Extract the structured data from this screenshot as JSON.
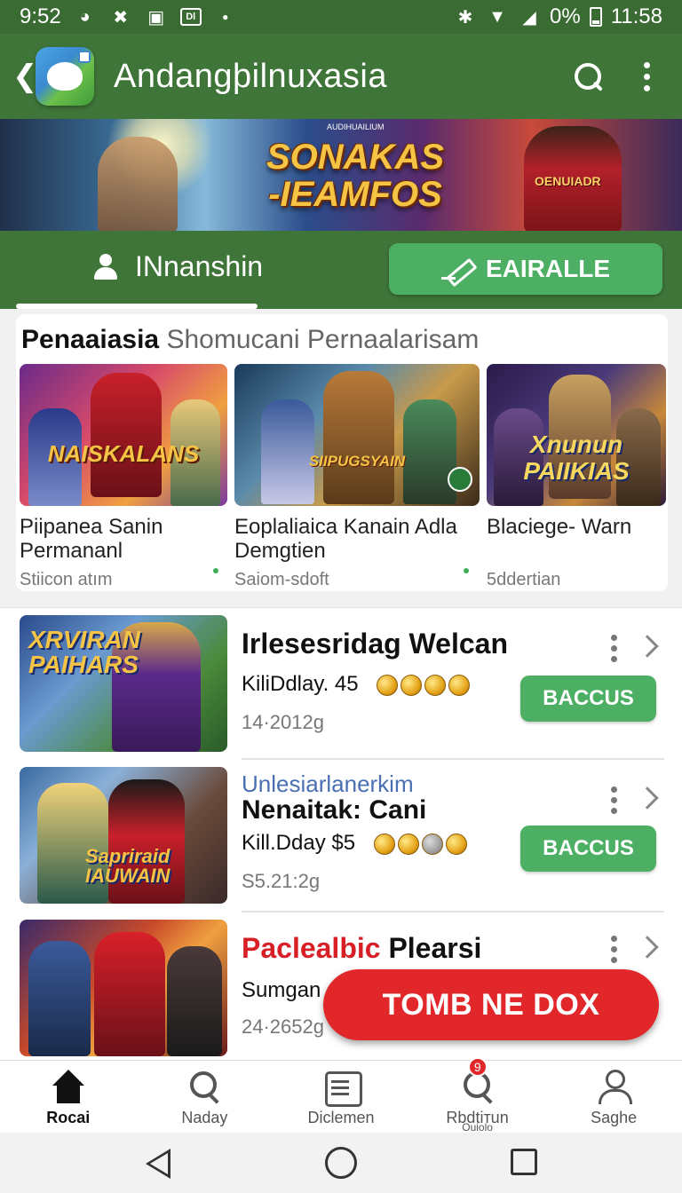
{
  "status": {
    "time_left": "9:52",
    "battery_pct": "0%",
    "time_right": "11:58",
    "icons": [
      "clock-icon",
      "x-icon",
      "image-icon",
      "dl-icon",
      "bluetooth-icon",
      "wifi-icon",
      "signal-icon",
      "battery-icon"
    ],
    "dl_label": "Dl"
  },
  "appbar": {
    "title": "Andangþilnuxasia"
  },
  "banner": {
    "title_line1": "SONAKAS",
    "title_line2": "-IEAMFOS",
    "tag": "OENUIADR",
    "small_text": "AUDIHUAILIUM"
  },
  "tabs": {
    "profile_label": "INnanshin",
    "edit_label": "EAIRALLE"
  },
  "featured": {
    "title_bold": "Penaaiasia",
    "title_rest": "Shomucani Pernaalarisam",
    "items": [
      {
        "art_label": "NAISKALANS",
        "name": "Piipanea Sanin Permananl",
        "meta": "Stiicon atım"
      },
      {
        "art_label": "SIIPUGSYAIN",
        "name": "Eoplaliaica Kanain Adla Demgtien",
        "meta": "Saiom-sdoft"
      },
      {
        "art_label": "Xnunun PAIIKIAS",
        "name": "Blaciege- Warn",
        "meta": "5ddertian"
      }
    ]
  },
  "list": [
    {
      "art_label": "XRVIRAN PAIHARS",
      "subtitle": "",
      "title": "Irlesesridag Welcan",
      "line": "KiliDdlay. 45",
      "date": "14·2012g",
      "button": "BACCUS"
    },
    {
      "art_label": "Sapriraid IAUWAIN",
      "subtitle": "Unlesiarlanerkim",
      "title": "Nenaitak: Cani",
      "line": "Kill.Dday $5",
      "date": "S5.21:2g",
      "button": "BACCUS"
    },
    {
      "art_label": "",
      "subtitle": "",
      "title_red": "Paclealbic",
      "title": "Plearsi",
      "line": "Sumgan",
      "date": "24·2652g",
      "button": ""
    }
  ],
  "fab": {
    "label": "TOMB NE DOX"
  },
  "bottom_nav": [
    {
      "label": "Rocai",
      "icon": "home-icon",
      "active": true
    },
    {
      "label": "Naday",
      "icon": "search-icon",
      "active": false
    },
    {
      "label": "Diclemen",
      "icon": "document-icon",
      "active": false
    },
    {
      "label": "Rbdtiтun",
      "icon": "search-notify-icon",
      "active": false,
      "badge": "9",
      "sub": "Ouiolo"
    },
    {
      "label": "Saghe",
      "icon": "user-icon",
      "active": false
    }
  ],
  "colors": {
    "primary_green": "#3f7538",
    "accent_green": "#4caf63",
    "fab_red": "#e2272b",
    "subtitle_blue": "#4a6fb3",
    "title_red": "#d81f26"
  }
}
